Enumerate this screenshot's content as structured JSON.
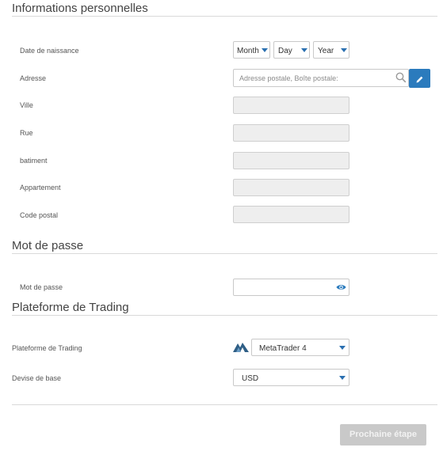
{
  "personal": {
    "title": "Informations personnelles",
    "birthdate_label": "Date de naissance",
    "month": "Month",
    "day": "Day",
    "year": "Year",
    "address_label": "Adresse",
    "address_placeholder": "Adresse postale, Boîte postale:",
    "city_label": "Ville",
    "street_label": "Rue",
    "building_label": "batiment",
    "apartment_label": "Appartement",
    "postal_label": "Code postal"
  },
  "password": {
    "title": "Mot de passe",
    "label": "Mot de passe"
  },
  "trading": {
    "title": "Plateforme de Trading",
    "platform_label": "Plateforme de Trading",
    "platform_value": "MetaTrader 4",
    "currency_label": "Devise de base",
    "currency_value": "USD"
  },
  "footer": {
    "next_label": "Prochaine étape"
  },
  "colors": {
    "accent": "#2b7bbd",
    "disabled_button": "#c9c9c9",
    "disabled_field": "#eeeeee"
  },
  "icons": [
    "search-icon",
    "pencil-icon",
    "eye-icon",
    "metatrader-logo-icon",
    "caret-down-icon"
  ]
}
